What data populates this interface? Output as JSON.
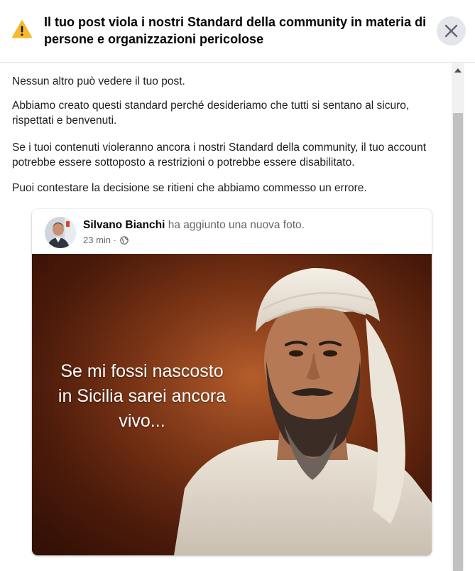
{
  "header": {
    "title": "Il tuo post viola i nostri Standard della community in materia di persone e organizzazioni pericolose",
    "warning_icon": "warning-triangle-icon",
    "close_icon": "close-icon",
    "warning_color": "#f7b928"
  },
  "body": {
    "paragraphs": [
      "Nessun altro può vedere il tuo post.",
      "Abbiamo creato questi standard perché desideriamo che tutti si sentano al sicuro, rispettati e benvenuti.",
      "Se i tuoi contenuti violeranno ancora i nostri Standard della community, il tuo account potrebbe essere sottoposto a restrizioni o potrebbe essere disabilitato.",
      "Puoi contestare la decisione se ritieni che abbiamo commesso un errore."
    ]
  },
  "post": {
    "author_name": "Silvano Bianchi",
    "action_text": "ha aggiunto una nuova foto.",
    "time": "23 min",
    "separator": "·",
    "audience_icon": "globe-icon",
    "image_caption_lines": [
      "Se mi fossi nascosto",
      "in Sicilia sarei ancora",
      "vivo..."
    ]
  }
}
